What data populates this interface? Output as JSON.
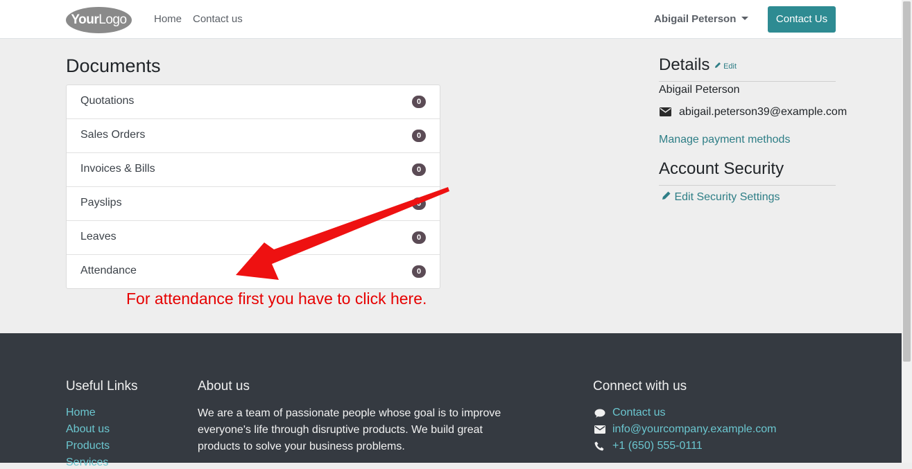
{
  "header": {
    "logo_text_bold": "Your",
    "logo_text_rest": "Logo",
    "nav": [
      {
        "label": "Home"
      },
      {
        "label": "Contact us"
      }
    ],
    "user_name": "Abigail Peterson",
    "contact_button": "Contact Us"
  },
  "documents": {
    "title": "Documents",
    "items": [
      {
        "label": "Quotations",
        "count": "0"
      },
      {
        "label": "Sales Orders",
        "count": "0"
      },
      {
        "label": "Invoices & Bills",
        "count": "0"
      },
      {
        "label": "Payslips",
        "count": "0"
      },
      {
        "label": "Leaves",
        "count": "0"
      },
      {
        "label": "Attendance",
        "count": "0"
      }
    ]
  },
  "annotation": {
    "text": "For attendance first you have to click here.",
    "color": "#e60000"
  },
  "details": {
    "title": "Details",
    "edit_label": "Edit",
    "name": "Abigail Peterson",
    "email": "abigail.peterson39@example.com",
    "manage_payment": "Manage payment methods"
  },
  "security": {
    "title": "Account Security",
    "edit_settings": "Edit Security Settings"
  },
  "footer": {
    "useful_links_title": "Useful Links",
    "useful_links": [
      "Home",
      "About us",
      "Products",
      "Services"
    ],
    "about_title": "About us",
    "about_text": "We are a team of passionate people whose goal is to improve everyone's life through disruptive products. We build great products to solve your business problems.",
    "connect_title": "Connect with us",
    "connect_items": [
      {
        "icon": "comment-icon",
        "label": "Contact us"
      },
      {
        "icon": "envelope-icon",
        "label": "info@yourcompany.example.com"
      },
      {
        "icon": "phone-icon",
        "label": "+1 (650) 555-0111"
      }
    ]
  },
  "colors": {
    "brand": "#2e8b92",
    "link": "#2e7e86",
    "badge": "#5b4b55",
    "footer_bg": "#353a41"
  }
}
